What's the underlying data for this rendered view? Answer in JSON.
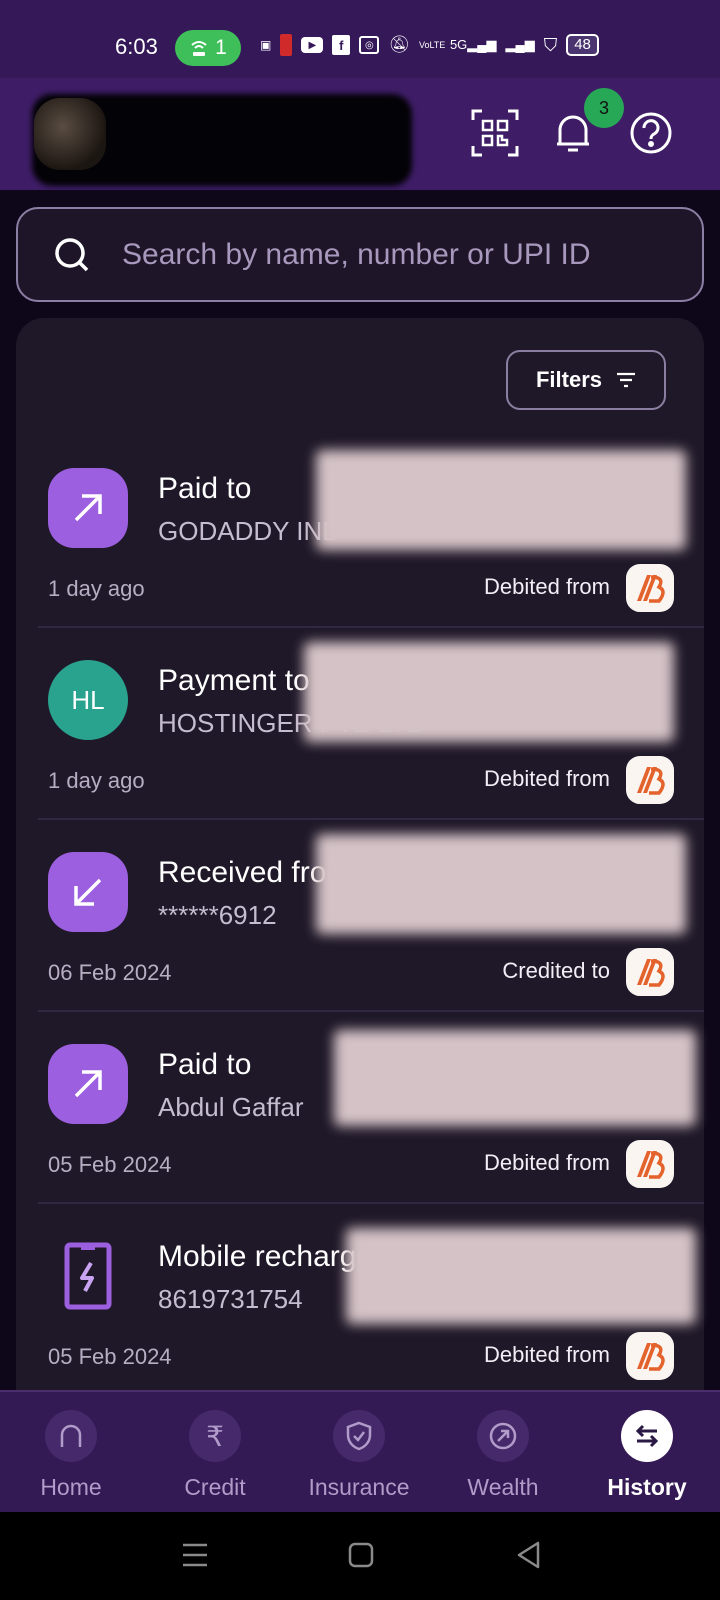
{
  "status_bar": {
    "time": "6:03",
    "hotspot_count": "1",
    "network_label": "5G",
    "volte_label": "VoLTE",
    "battery": "48"
  },
  "header": {
    "notification_count": "3",
    "icons": [
      "qr-scan-icon",
      "bell-icon",
      "help-icon"
    ]
  },
  "search": {
    "placeholder": "Search by name, number or UPI ID",
    "value": ""
  },
  "filters": {
    "label": "Filters"
  },
  "transactions": [
    {
      "icon": "arrow-up-right-icon",
      "title": "Paid to",
      "subtitle": "GODADDY IND",
      "date": "1 day ago",
      "bank_label": "Debited from",
      "bank": "bank-of-baroda-logo",
      "amount_redacted": true
    },
    {
      "icon": "initials-avatar",
      "initials": "HL",
      "title": "Payment to",
      "subtitle": "HOSTINGER PTE LTD",
      "date": "1 day ago",
      "bank_label": "Debited from",
      "bank": "bank-of-baroda-logo",
      "amount_redacted": true
    },
    {
      "icon": "arrow-down-left-icon",
      "title": "Received from",
      "subtitle": "******6912",
      "date": "06 Feb 2024",
      "bank_label": "Credited to",
      "bank": "bank-of-baroda-logo",
      "amount_redacted": true
    },
    {
      "icon": "arrow-up-right-icon",
      "title": "Paid to",
      "subtitle": "Abdul Gaffar",
      "date": "05 Feb 2024",
      "bank_label": "Debited from",
      "bank": "bank-of-baroda-logo",
      "amount_redacted": true
    },
    {
      "icon": "mobile-recharge-icon",
      "title": "Mobile recharged",
      "subtitle": "8619731754",
      "date": "05 Feb 2024",
      "bank_label": "Debited from",
      "bank": "bank-of-baroda-logo",
      "amount_redacted": true
    }
  ],
  "bottom_nav": [
    {
      "label": "Home",
      "icon": "home-icon",
      "active": false
    },
    {
      "label": "Credit",
      "icon": "rupee-icon",
      "active": false
    },
    {
      "label": "Insurance",
      "icon": "shield-check-icon",
      "active": false
    },
    {
      "label": "Wealth",
      "icon": "wealth-arrow-icon",
      "active": false
    },
    {
      "label": "History",
      "icon": "swap-arrows-icon",
      "active": true
    }
  ],
  "colors": {
    "brand_purple": "#3e1d66",
    "accent_purple": "#9b5fe0",
    "badge_green": "#27a857",
    "avatar_teal": "#2aa38e",
    "card_bg": "#1f1828"
  }
}
